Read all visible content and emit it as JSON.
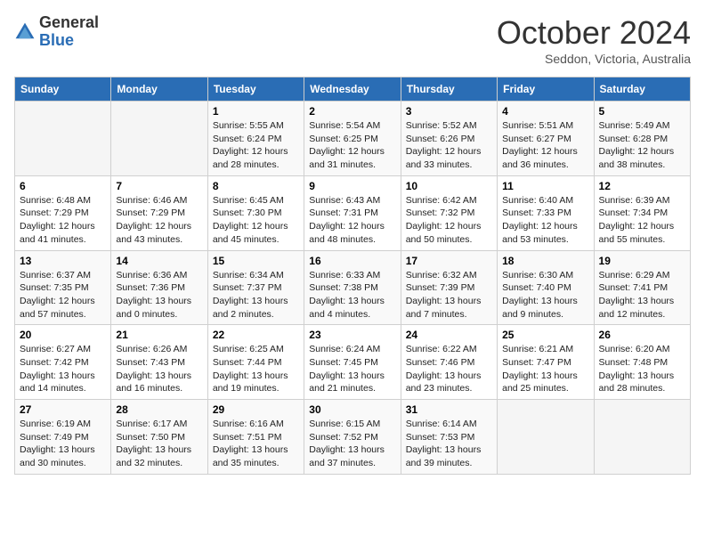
{
  "header": {
    "logo_general": "General",
    "logo_blue": "Blue",
    "month_title": "October 2024",
    "subtitle": "Seddon, Victoria, Australia"
  },
  "days_of_week": [
    "Sunday",
    "Monday",
    "Tuesday",
    "Wednesday",
    "Thursday",
    "Friday",
    "Saturday"
  ],
  "weeks": [
    [
      {
        "day": "",
        "info": ""
      },
      {
        "day": "",
        "info": ""
      },
      {
        "day": "1",
        "info": "Sunrise: 5:55 AM\nSunset: 6:24 PM\nDaylight: 12 hours and 28 minutes."
      },
      {
        "day": "2",
        "info": "Sunrise: 5:54 AM\nSunset: 6:25 PM\nDaylight: 12 hours and 31 minutes."
      },
      {
        "day": "3",
        "info": "Sunrise: 5:52 AM\nSunset: 6:26 PM\nDaylight: 12 hours and 33 minutes."
      },
      {
        "day": "4",
        "info": "Sunrise: 5:51 AM\nSunset: 6:27 PM\nDaylight: 12 hours and 36 minutes."
      },
      {
        "day": "5",
        "info": "Sunrise: 5:49 AM\nSunset: 6:28 PM\nDaylight: 12 hours and 38 minutes."
      }
    ],
    [
      {
        "day": "6",
        "info": "Sunrise: 6:48 AM\nSunset: 7:29 PM\nDaylight: 12 hours and 41 minutes."
      },
      {
        "day": "7",
        "info": "Sunrise: 6:46 AM\nSunset: 7:29 PM\nDaylight: 12 hours and 43 minutes."
      },
      {
        "day": "8",
        "info": "Sunrise: 6:45 AM\nSunset: 7:30 PM\nDaylight: 12 hours and 45 minutes."
      },
      {
        "day": "9",
        "info": "Sunrise: 6:43 AM\nSunset: 7:31 PM\nDaylight: 12 hours and 48 minutes."
      },
      {
        "day": "10",
        "info": "Sunrise: 6:42 AM\nSunset: 7:32 PM\nDaylight: 12 hours and 50 minutes."
      },
      {
        "day": "11",
        "info": "Sunrise: 6:40 AM\nSunset: 7:33 PM\nDaylight: 12 hours and 53 minutes."
      },
      {
        "day": "12",
        "info": "Sunrise: 6:39 AM\nSunset: 7:34 PM\nDaylight: 12 hours and 55 minutes."
      }
    ],
    [
      {
        "day": "13",
        "info": "Sunrise: 6:37 AM\nSunset: 7:35 PM\nDaylight: 12 hours and 57 minutes."
      },
      {
        "day": "14",
        "info": "Sunrise: 6:36 AM\nSunset: 7:36 PM\nDaylight: 13 hours and 0 minutes."
      },
      {
        "day": "15",
        "info": "Sunrise: 6:34 AM\nSunset: 7:37 PM\nDaylight: 13 hours and 2 minutes."
      },
      {
        "day": "16",
        "info": "Sunrise: 6:33 AM\nSunset: 7:38 PM\nDaylight: 13 hours and 4 minutes."
      },
      {
        "day": "17",
        "info": "Sunrise: 6:32 AM\nSunset: 7:39 PM\nDaylight: 13 hours and 7 minutes."
      },
      {
        "day": "18",
        "info": "Sunrise: 6:30 AM\nSunset: 7:40 PM\nDaylight: 13 hours and 9 minutes."
      },
      {
        "day": "19",
        "info": "Sunrise: 6:29 AM\nSunset: 7:41 PM\nDaylight: 13 hours and 12 minutes."
      }
    ],
    [
      {
        "day": "20",
        "info": "Sunrise: 6:27 AM\nSunset: 7:42 PM\nDaylight: 13 hours and 14 minutes."
      },
      {
        "day": "21",
        "info": "Sunrise: 6:26 AM\nSunset: 7:43 PM\nDaylight: 13 hours and 16 minutes."
      },
      {
        "day": "22",
        "info": "Sunrise: 6:25 AM\nSunset: 7:44 PM\nDaylight: 13 hours and 19 minutes."
      },
      {
        "day": "23",
        "info": "Sunrise: 6:24 AM\nSunset: 7:45 PM\nDaylight: 13 hours and 21 minutes."
      },
      {
        "day": "24",
        "info": "Sunrise: 6:22 AM\nSunset: 7:46 PM\nDaylight: 13 hours and 23 minutes."
      },
      {
        "day": "25",
        "info": "Sunrise: 6:21 AM\nSunset: 7:47 PM\nDaylight: 13 hours and 25 minutes."
      },
      {
        "day": "26",
        "info": "Sunrise: 6:20 AM\nSunset: 7:48 PM\nDaylight: 13 hours and 28 minutes."
      }
    ],
    [
      {
        "day": "27",
        "info": "Sunrise: 6:19 AM\nSunset: 7:49 PM\nDaylight: 13 hours and 30 minutes."
      },
      {
        "day": "28",
        "info": "Sunrise: 6:17 AM\nSunset: 7:50 PM\nDaylight: 13 hours and 32 minutes."
      },
      {
        "day": "29",
        "info": "Sunrise: 6:16 AM\nSunset: 7:51 PM\nDaylight: 13 hours and 35 minutes."
      },
      {
        "day": "30",
        "info": "Sunrise: 6:15 AM\nSunset: 7:52 PM\nDaylight: 13 hours and 37 minutes."
      },
      {
        "day": "31",
        "info": "Sunrise: 6:14 AM\nSunset: 7:53 PM\nDaylight: 13 hours and 39 minutes."
      },
      {
        "day": "",
        "info": ""
      },
      {
        "day": "",
        "info": ""
      }
    ]
  ]
}
